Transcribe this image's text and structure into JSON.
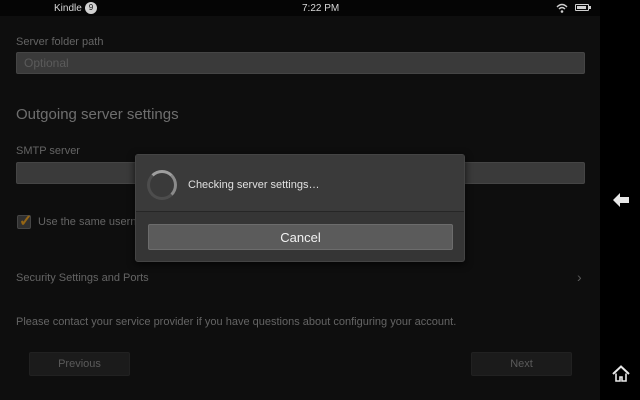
{
  "statusbar": {
    "app_name": "Kindle",
    "notification_count": "9",
    "time": "7:22 PM",
    "icons": [
      "wifi-icon",
      "battery-icon"
    ]
  },
  "form": {
    "server_folder_path": {
      "label": "Server folder path",
      "placeholder": "Optional",
      "value": ""
    },
    "outgoing_title": "Outgoing server settings",
    "smtp_server": {
      "label": "SMTP server",
      "value": ""
    },
    "same_credentials_checkbox": {
      "label": "Use the same userna",
      "checked": true
    },
    "security_settings": "Security Settings and Ports",
    "contact_info": "Please contact your service provider if you have questions about configuring your account."
  },
  "nav": {
    "previous": "Previous",
    "next": "Next"
  },
  "dialog": {
    "message": "Checking server settings…",
    "cancel": "Cancel"
  },
  "sidebar": {
    "icons": [
      "back-arrow-icon",
      "home-icon"
    ]
  },
  "colors": {
    "checkmark": "#e49b20",
    "dialog_bg": "#353535",
    "content_bg": "#161616"
  }
}
